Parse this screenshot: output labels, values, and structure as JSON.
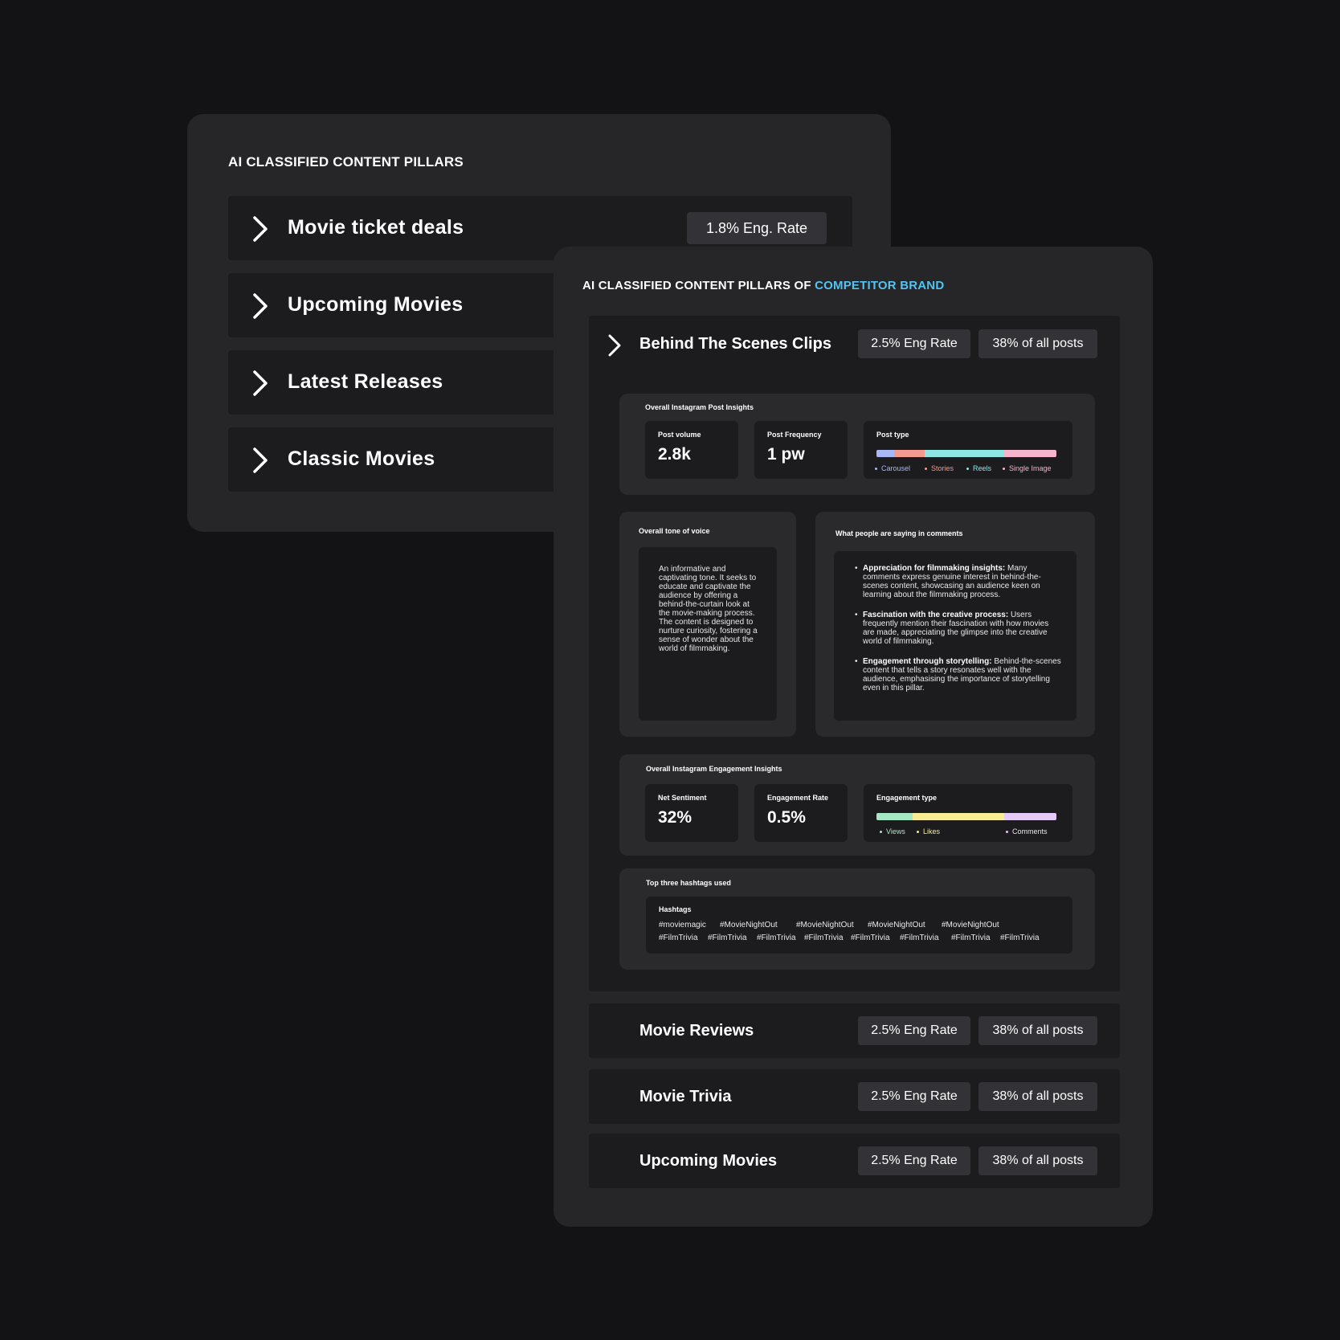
{
  "back_panel": {
    "title": "AI CLASSIFIED CONTENT PILLARS",
    "rows": [
      {
        "label": "Movie ticket deals",
        "metric": "1.8% Eng. Rate"
      },
      {
        "label": "Upcoming Movies"
      },
      {
        "label": "Latest Releases"
      },
      {
        "label": "Classic Movies"
      }
    ]
  },
  "front_panel": {
    "title_prefix": "AI CLASSIFIED CONTENT PILLARS OF ",
    "title_accent": "COMPETITOR BRAND",
    "accent_color": "#54c3f2",
    "expanded_row": {
      "label": "Behind The Scenes Clips",
      "eng_rate": "2.5% Eng Rate",
      "share": "38% of all posts",
      "post_insights": {
        "title": "Overall Instagram Post Insights",
        "post_volume_label": "Post volume",
        "post_volume_value": "2.8k",
        "post_frequency_label": "Post Frequency",
        "post_frequency_value": "1 pw",
        "post_type_label": "Post type",
        "post_type_segments": [
          {
            "name": "Carousel",
            "share": 0.1,
            "color": "#a9b8f5"
          },
          {
            "name": "Stories",
            "share": 0.17,
            "color": "#f39b8e"
          },
          {
            "name": "Reels",
            "share": 0.44,
            "color": "#8ee6e4"
          },
          {
            "name": "Single Image",
            "share": 0.29,
            "color": "#f6b4cd"
          }
        ]
      },
      "tone": {
        "title": "Overall tone of voice",
        "text": "An informative and captivating tone. It seeks to educate and captivate the audience by offering a behind-the-curtain look at the movie-making process. The content is designed to nurture curiosity, fostering a sense of wonder about the world of filmmaking."
      },
      "comments": {
        "title": "What people are saying in comments",
        "items": [
          {
            "heading": "Appreciation for filmmaking insights:",
            "body": " Many comments express genuine interest in behind-the-scenes content, showcasing an audience keen on learning about the filmmaking process."
          },
          {
            "heading": "Fascination with the creative process:",
            "body": " Users frequently mention their fascination with how movies are made, appreciating the glimpse into the creative world of filmmaking."
          },
          {
            "heading": "Engagement through storytelling:",
            "body": " Behind-the-scenes content that tells a story resonates well with the audience, emphasising the importance of storytelling even in this pillar."
          }
        ]
      },
      "engagement_insights": {
        "title": "Overall Instagram Engagement Insights",
        "net_sentiment_label": "Net Sentiment",
        "net_sentiment_value": "32%",
        "engagement_rate_label": "Engagement Rate",
        "engagement_rate_value": "0.5%",
        "engagement_type_label": "Engagement type",
        "engagement_type_segments": [
          {
            "name": "Views",
            "share": 0.2,
            "color": "#a6e7c3"
          },
          {
            "name": "Likes",
            "share": 0.51,
            "color": "#f7eb94"
          },
          {
            "name": "Comments",
            "share": 0.29,
            "color": "#e5c9f6"
          }
        ]
      },
      "hashtags": {
        "title": "Top three hashtags used",
        "label": "Hashtags",
        "row1": [
          "#moviemagic",
          "#MovieNightOut",
          "#MovieNightOut",
          "#MovieNightOut",
          "#MovieNightOut"
        ],
        "row2": [
          "#FilmTrivia",
          "#FilmTrivia",
          "#FilmTrivia",
          "#FilmTrivia",
          "#FilmTrivia",
          "#FilmTrivia",
          "#FilmTrivia",
          "#FilmTrivia"
        ]
      }
    },
    "collapsed_rows": [
      {
        "label": "Movie Reviews",
        "eng_rate": "2.5% Eng Rate",
        "share": "38% of all posts"
      },
      {
        "label": "Movie Trivia",
        "eng_rate": "2.5% Eng Rate",
        "share": "38% of all posts"
      },
      {
        "label": "Upcoming Movies",
        "eng_rate": "2.5% Eng Rate",
        "share": "38% of all posts"
      }
    ]
  }
}
